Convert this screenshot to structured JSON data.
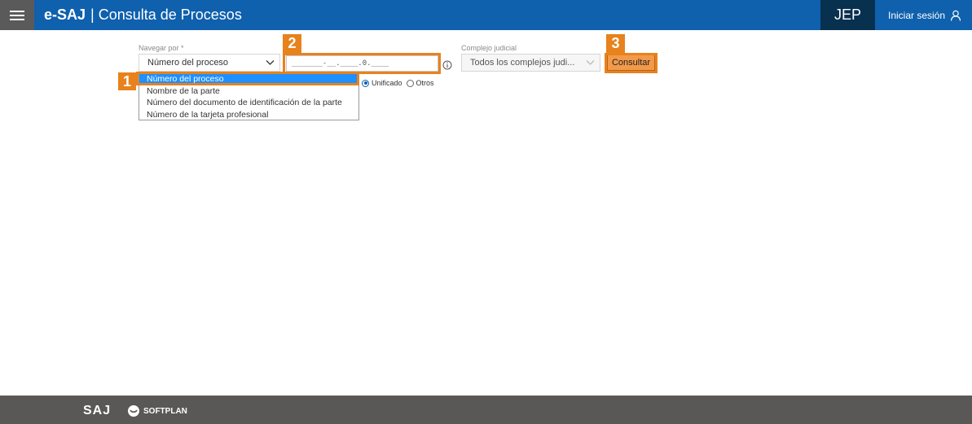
{
  "header": {
    "brand": "e-SAJ",
    "separator": "|",
    "title": "Consulta de Procesos",
    "court": "JEP",
    "login_label": "Iniciar sesión",
    "menu_icon": "hamburger-menu-icon",
    "login_icon": "user-icon",
    "colors": {
      "bar": "#0f60ad",
      "menu": "#5a5a5a",
      "court_bg": "#08304f"
    }
  },
  "search": {
    "navigate_by": {
      "label": "Navegar por *",
      "selected": "Número del proceso",
      "options": [
        "Número del proceso",
        "Nombre de la parte",
        "Número del documento de identificación de la parte",
        "Número de la tarjeta profesional"
      ]
    },
    "process_number": {
      "mask": "_______-__.____.0.____",
      "info_icon": "info-icon"
    },
    "number_type": {
      "options": [
        "Unificado",
        "Otros"
      ],
      "selected": "Unificado"
    },
    "judicial_complex": {
      "label": "Complejo judicial",
      "selected": "Todos los complejos judi..."
    },
    "submit_label": "Consultar"
  },
  "annotations": [
    "1",
    "2",
    "3"
  ],
  "annotation_color": "#e8821c",
  "footer": {
    "logo_saj": "SAJ",
    "logo_softplan": "SOFTPLAN"
  }
}
